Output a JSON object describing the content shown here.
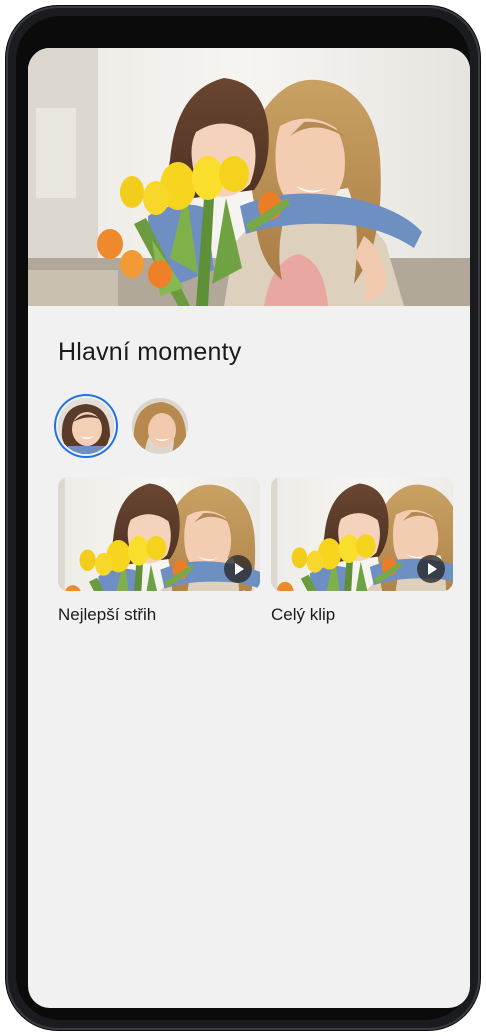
{
  "highlights": {
    "title": "Hlavní momenty",
    "faces": [
      {
        "label": "",
        "selected": true
      },
      {
        "label": "",
        "selected": false
      }
    ],
    "clips": [
      {
        "label": "Nejlepší střih",
        "icon": "play-icon"
      },
      {
        "label": "Celý klip",
        "icon": "play-icon"
      }
    ]
  },
  "colors": {
    "background": "#f1f1f1",
    "accent": "#1f74e5",
    "text": "#1a1a1a"
  }
}
